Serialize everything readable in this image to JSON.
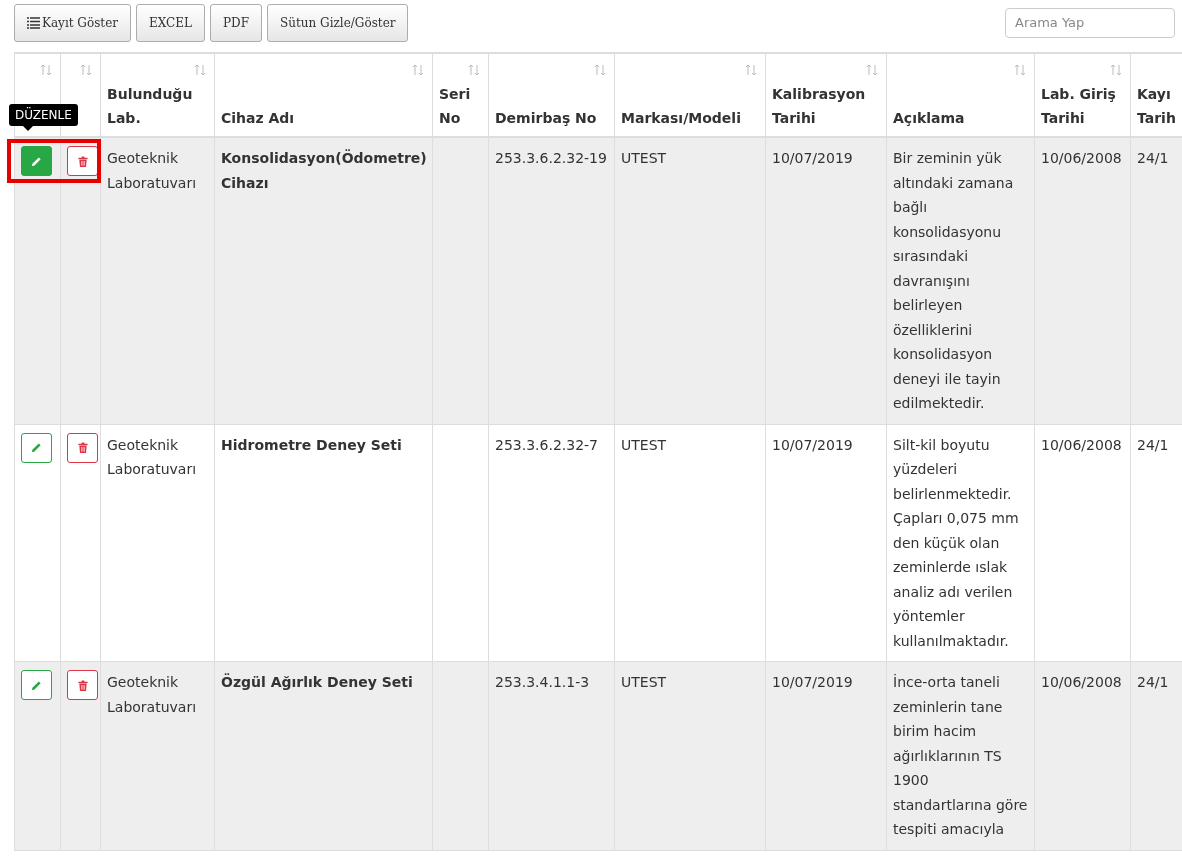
{
  "toolbar": {
    "buttons": [
      {
        "label": "Kayıt Göster",
        "kind": "list"
      },
      {
        "label": "EXCEL",
        "kind": "plain"
      },
      {
        "label": "PDF",
        "kind": "plain"
      },
      {
        "label": "Sütun Gizle/Göster",
        "kind": "plain"
      }
    ],
    "search": {
      "placeholder": "Arama Yap"
    }
  },
  "table": {
    "columns": [
      {
        "sortable": true
      },
      {
        "sortable": true
      },
      {
        "label": "Bulunduğu Lab.",
        "sortable": true
      },
      {
        "label": "Cihaz Adı",
        "sortable": true
      },
      {
        "label": "Seri No",
        "sortable": true
      },
      {
        "label": "Demirbaş No",
        "sortable": true
      },
      {
        "label": "Markası/Modeli",
        "sortable": true
      },
      {
        "label": "Kalibrasyon Tarihi",
        "sortable": true
      },
      {
        "label": "Açıklama",
        "sortable": true
      },
      {
        "label": "Lab. Giriş Tarihi",
        "sortable": true
      },
      {
        "label": "Kayı Tarih",
        "sortable": false
      }
    ],
    "rows": [
      {
        "highlighted": true,
        "edit_tooltip": "DÜZENLE",
        "lab": "Geoteknik Laboratuvarı",
        "name": "Konsolidasyon(Ödometre) Cihazı",
        "asset_no": "253.3.6.2.32-19",
        "brand": "UTEST",
        "calibration": "10/07/2019",
        "description": "Bir zeminin yük altındaki zamana bağlı konsolidasyonu sırasındaki davranışını belirleyen özelliklerini konsolidasyon deneyi ile tayin edilmektedir.",
        "lab_entry": "10/06/2008",
        "record": "24/1"
      },
      {
        "highlighted": false,
        "lab": "Geoteknik Laboratuvarı",
        "name": "Hidrometre Deney Seti",
        "asset_no": "253.3.6.2.32-7",
        "brand": "UTEST",
        "calibration": "10/07/2019",
        "description": "Silt-kil boyutu yüzdeleri belirlenmektedir. Çapları 0,075 mm den küçük olan zeminlerde ıslak analiz adı verilen yöntemler kullanılmaktadır.",
        "lab_entry": "10/06/2008",
        "record": "24/1"
      },
      {
        "highlighted": false,
        "lab": "Geoteknik Laboratuvarı",
        "name": "Özgül Ağırlık Deney Seti",
        "asset_no": "253.3.4.1.1-3",
        "brand": "UTEST",
        "calibration": "10/07/2019",
        "description": "İnce-orta taneli zeminlerin tane birim hacim ağırlıklarının TS 1900 standartlarına göre tespiti amacıyla",
        "lab_entry": "10/06/2008",
        "record": "24/1"
      }
    ]
  }
}
